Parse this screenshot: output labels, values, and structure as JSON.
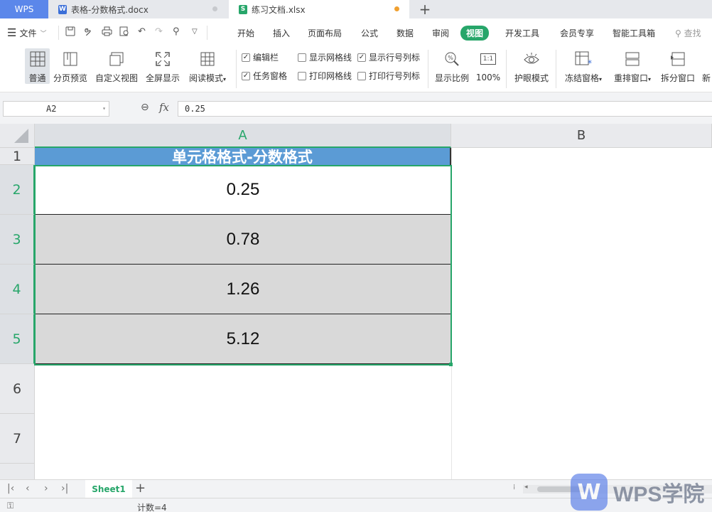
{
  "tabs": {
    "home": "WPS",
    "doc": {
      "icon": "W",
      "label": "表格-分数格式.docx"
    },
    "xls": {
      "icon": "S",
      "label": "练习文档.xlsx"
    },
    "add": "+"
  },
  "menu": {
    "file": "文件",
    "tabs": [
      "开始",
      "插入",
      "页面布局",
      "公式",
      "数据",
      "审阅",
      "视图",
      "开发工具",
      "会员专享",
      "智能工具箱"
    ],
    "active": "视图",
    "search": "查找"
  },
  "ribbon": {
    "normal": "普通",
    "page_break": "分页预览",
    "custom_view": "自定义视图",
    "fullscreen": "全屏显示",
    "reading_mode": "阅读模式",
    "checks": {
      "formula_bar": {
        "label": "编辑栏",
        "checked": true
      },
      "show_gridlines": {
        "label": "显示网格线",
        "checked": false
      },
      "show_headings": {
        "label": "显示行号列标",
        "checked": true
      },
      "task_pane": {
        "label": "任务窗格",
        "checked": true
      },
      "print_gridlines": {
        "label": "打印网格线",
        "checked": false
      },
      "print_headings": {
        "label": "打印行号列标",
        "checked": false
      }
    },
    "zoom": "显示比例",
    "zoom_100": "100%",
    "zoom_100_icon": "1:1",
    "eye_mode": "护眼模式",
    "freeze": "冻结窗格",
    "rearrange": "重排窗口",
    "split": "拆分窗口",
    "new": "新"
  },
  "formula_bar": {
    "cell_ref": "A2",
    "fx": "fx",
    "value": "0.25"
  },
  "sheet": {
    "columns": [
      "A",
      "B"
    ],
    "rows": [
      "1",
      "2",
      "3",
      "4",
      "5",
      "6",
      "7"
    ],
    "title": "单元格格式-分数格式",
    "values": [
      "0.25",
      "0.78",
      "1.26",
      "5.12"
    ],
    "colors": {
      "title_bg": "#5b9bd5",
      "selection": "#27a66a",
      "gray_fill": "#d9d9d9"
    }
  },
  "sheet_tabs": {
    "active": "Sheet1",
    "add": "+"
  },
  "status": {
    "count": "计数=4"
  },
  "watermark": {
    "logo": "W",
    "text": "WPS学院"
  }
}
